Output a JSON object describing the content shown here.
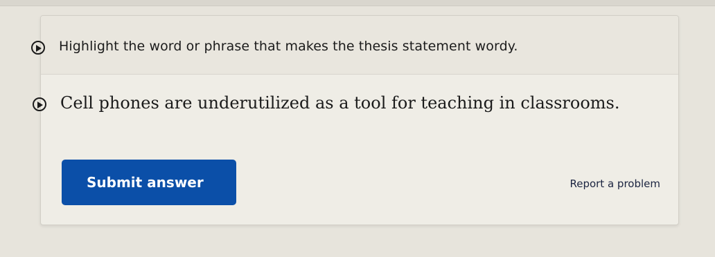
{
  "instruction": {
    "audio_icon": "play-circle-icon",
    "text": "Highlight the word or phrase that makes the thesis statement wordy."
  },
  "question": {
    "audio_icon": "play-circle-icon",
    "sentence": "Cell phones are underutilized as a tool for teaching in classrooms."
  },
  "actions": {
    "submit_label": "Submit answer",
    "report_label": "Report a problem"
  },
  "colors": {
    "submit_button": "#0b4fa8",
    "background": "#e7e4dc",
    "card": "#efede6"
  }
}
